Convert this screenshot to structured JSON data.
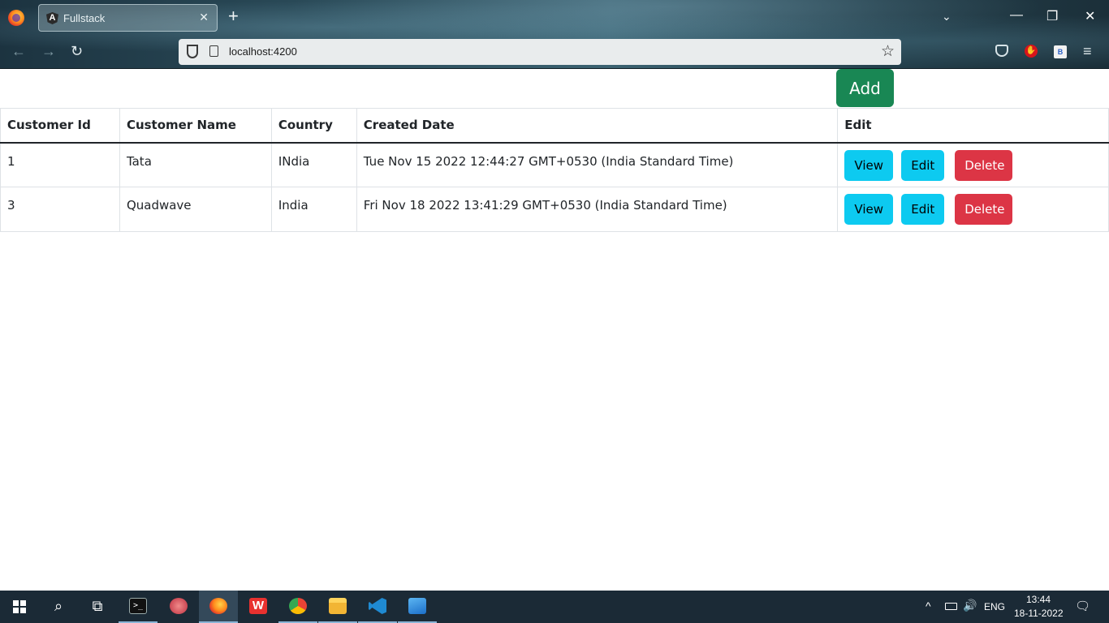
{
  "browser": {
    "tab_title": "Fullstack",
    "tab_icon": "A",
    "url": "localhost:4200",
    "new_tab": "+",
    "close_tab": "✕",
    "list_tabs": "⌄",
    "minimize": "—",
    "restore": "❐",
    "close": "✕",
    "back": "←",
    "forward": "→",
    "reload": "↻",
    "bookmark": "☆",
    "menu": "≡",
    "ublock_label": "✋",
    "bitdefender_label": "B"
  },
  "page": {
    "add_label": "Add",
    "columns": [
      "Customer Id",
      "Customer Name",
      "Country",
      "Created Date",
      "Edit"
    ],
    "rows": [
      {
        "id": "1",
        "name": "Tata",
        "country": "INdia",
        "created": "Tue Nov 15 2022 12:44:27 GMT+0530 (India Standard Time)"
      },
      {
        "id": "3",
        "name": "Quadwave",
        "country": "India",
        "created": "Fri Nov 18 2022 13:41:29 GMT+0530 (India Standard Time)"
      }
    ],
    "view_label": "View",
    "edit_label": "Edit",
    "delete_label": "Delete"
  },
  "taskbar": {
    "search_glyph": "⌕",
    "taskview_glyph": "⧉",
    "terminal_glyph": ">_",
    "wps_glyph": "W",
    "lang": "ENG",
    "time": "13:44",
    "date": "18-11-2022",
    "chevron": "^",
    "volume": "🔊",
    "notification": "🗨"
  },
  "colors": {
    "add": "#198754",
    "info": "#0dcaf0",
    "danger": "#dc3545"
  }
}
